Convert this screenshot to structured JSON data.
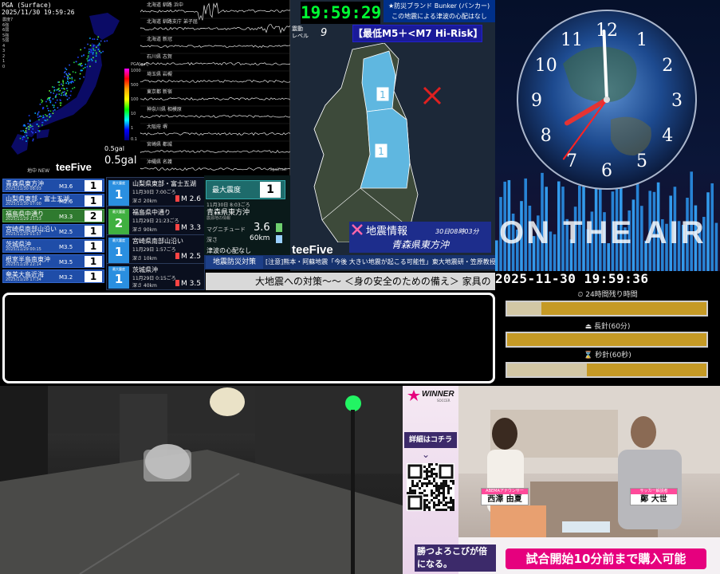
{
  "seismic": {
    "title": "PGA (Surface)",
    "datetime": "2025/11/30 19:59:26",
    "legend": [
      "震度7",
      "6強",
      "6弱",
      "5強",
      "5弱",
      "4",
      "3",
      "2",
      "1",
      "0"
    ],
    "scale_label": "PGA[gal]",
    "scale_ticks": [
      "1000",
      "500",
      "100",
      "10",
      "1",
      "0.1"
    ],
    "gal_small": "0.5gal",
    "gal_big": "0.5gal",
    "station_header": "北海道 釧路 浜中",
    "stations": [
      "北海道 釧路支庁 弟子屈",
      "北海道 新冠",
      "石川県 志賀",
      "埼玉県 岩槻",
      "東京都 新宿",
      "神奈川県 相模原",
      "大阪府 堺",
      "宮崎県 都城",
      "沖縄県 名護"
    ],
    "brand": "teeFive",
    "footer_left": "地中 NEW",
    "footer_right": "3gal/row"
  },
  "eew": {
    "clock": "19:59:29",
    "banner_title": "★防災ブランド Bunker (バンカー)",
    "banner_sub": "この地震による津波の心配はなし",
    "level_label": "震動\nレベル",
    "level_value": "9",
    "risk": "【最低M5＋<M7 Hi-Risk】",
    "map_intensity_1": "1",
    "map_intensity_2": "1",
    "info_label": "地震情報",
    "info_time": "30日08時03分",
    "info_region": "青森県東方沖",
    "brand": "teeFive"
  },
  "quake_list": [
    {
      "region": "青森県東方沖",
      "time": "2025/11/30 08:03",
      "mag": "M3.6",
      "intensity": "1",
      "highlight": false
    },
    {
      "region": "山梨県東部・富士五湖",
      "time": "2025/11/30 07:00",
      "mag": "M2.6",
      "intensity": "1",
      "highlight": false
    },
    {
      "region": "福島県中通り",
      "time": "2025/11/29 21:23",
      "mag": "M3.3",
      "intensity": "2",
      "highlight": true
    },
    {
      "region": "宮崎県南部山沿い",
      "time": "2025/11/29 01:57",
      "mag": "M2.5",
      "intensity": "1",
      "highlight": false
    },
    {
      "region": "茨城県沖",
      "time": "2025/11/29 00:15",
      "mag": "M3.5",
      "intensity": "1",
      "highlight": false
    },
    {
      "region": "根室半島南東沖",
      "time": "2025/11/28 22:14",
      "mag": "M3.5",
      "intensity": "1",
      "highlight": false
    },
    {
      "region": "奄美大島近海",
      "time": "2025/11/28 17:34",
      "mag": "M3.2",
      "intensity": "1",
      "highlight": false
    }
  ],
  "quake_cards": [
    {
      "label": "最大震度",
      "intensity": "1",
      "region": "山梨県東部・富士五湖",
      "time": "11月30日 7:00ごろ",
      "depth": "深さ 20km",
      "mag": "M 2.6"
    },
    {
      "label": "最大震度",
      "intensity": "2",
      "region": "福島県中通り",
      "time": "11月29日 21:23ごろ",
      "depth": "深さ 90km",
      "mag": "M 3.3"
    },
    {
      "label": "最大震度",
      "intensity": "1",
      "region": "宮崎県南部山沿い",
      "time": "11月29日 1:57ごろ",
      "depth": "深さ 10km",
      "mag": "M 2.5"
    },
    {
      "label": "最大震度",
      "intensity": "1",
      "region": "茨城県沖",
      "time": "11月29日 0:15ごろ",
      "depth": "深さ 40km",
      "mag": "M 3.5"
    }
  ],
  "detail": {
    "max_label": "最大震度",
    "max_value": "1",
    "time": "11月30日 8:03ごろ",
    "region": "青森県東方沖",
    "sub": "震源地の情報",
    "mag_label": "マグニチュード",
    "mag_value": "3.6",
    "depth_label": "深さ",
    "depth_value": "60km",
    "tsunami": "津波の心配なし"
  },
  "ticker": {
    "label": "地震防災対策",
    "text1": "[注意]熊本・阿蘇地震「今後 大きい地震が起こる可能性」東大地震研・笠原教授",
    "text2": "大地震への対策〜〜 ＜身の安全のための備え＞ 家具の"
  },
  "clock": {
    "numbers": [
      "12",
      "1",
      "2",
      "3",
      "4",
      "5",
      "6",
      "7",
      "8",
      "9",
      "10",
      "11"
    ],
    "on_air": "ON THE AIR",
    "datetime": "2025-11-30 19:59:36",
    "colors": {
      "hour": "#e53333",
      "minute": "#ffffff",
      "second": "#ff2222"
    }
  },
  "countdowns": [
    {
      "label": "24時間残り時間",
      "icon": "clock-icon",
      "progress": 0.17
    },
    {
      "label": "長針(60分)",
      "icon": "long-hand-icon",
      "progress": 0.0
    },
    {
      "label": "秒針(60秒)",
      "icon": "hourglass-icon",
      "progress": 0.4
    }
  ],
  "ad": {
    "logo": "WINNER",
    "logo_sub": "SOCCER",
    "detail_label": "詳細はコチラ",
    "person1_role": "ABEMAアナウンサー",
    "person1_name": "西澤 由夏",
    "person2_role": "サッカー解説者",
    "person2_name": "鄭 大世",
    "slogan": "勝つよろこびが倍になる。",
    "cta": "試合開始10分前まで購入可能",
    "accent": "#e6007e"
  }
}
